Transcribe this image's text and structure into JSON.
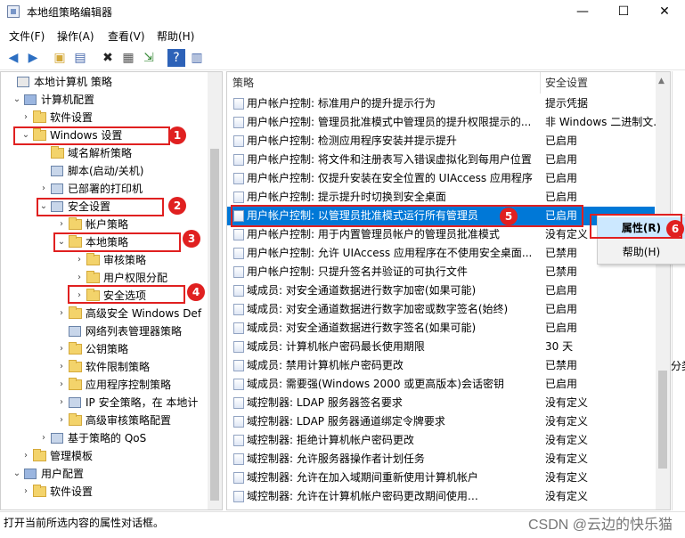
{
  "window": {
    "title": "本地组策略编辑器"
  },
  "menu": [
    "文件(F)",
    "操作(A)",
    "查看(V)",
    "帮助(H)"
  ],
  "toolbar_icons": [
    "back-arrow-icon",
    "forward-arrow-icon",
    "folder-up-icon",
    "show-hide-tree-icon",
    "delete-x-icon",
    "properties-icon",
    "export-icon",
    "help-icon",
    "console-icon"
  ],
  "tree": [
    {
      "label": "本地计算机 策略",
      "level": 0,
      "arrow": ""
    },
    {
      "label": "计算机配置",
      "level": 1,
      "arrow": "⌄"
    },
    {
      "label": "软件设置",
      "level": 2,
      "arrow": "›"
    },
    {
      "label": "Windows 设置",
      "level": 2,
      "arrow": "⌄"
    },
    {
      "label": "域名解析策略",
      "level": 3,
      "arrow": ""
    },
    {
      "label": "脚本(启动/关机)",
      "level": 3,
      "arrow": ""
    },
    {
      "label": "已部署的打印机",
      "level": 3,
      "arrow": "›"
    },
    {
      "label": "安全设置",
      "level": 3,
      "arrow": "⌄"
    },
    {
      "label": "帐户策略",
      "level": 4,
      "arrow": "›"
    },
    {
      "label": "本地策略",
      "level": 4,
      "arrow": "⌄"
    },
    {
      "label": "审核策略",
      "level": 5,
      "arrow": "›"
    },
    {
      "label": "用户权限分配",
      "level": 5,
      "arrow": "›"
    },
    {
      "label": "安全选项",
      "level": 5,
      "arrow": "›"
    },
    {
      "label": "高级安全 Windows Def",
      "level": 4,
      "arrow": "›"
    },
    {
      "label": "网络列表管理器策略",
      "level": 4,
      "arrow": ""
    },
    {
      "label": "公钥策略",
      "level": 4,
      "arrow": "›"
    },
    {
      "label": "软件限制策略",
      "level": 4,
      "arrow": "›"
    },
    {
      "label": "应用程序控制策略",
      "level": 4,
      "arrow": "›"
    },
    {
      "label": "IP 安全策略，在 本地计",
      "level": 4,
      "arrow": "›"
    },
    {
      "label": "高级审核策略配置",
      "level": 4,
      "arrow": "›"
    },
    {
      "label": "基于策略的 QoS",
      "level": 3,
      "arrow": "›"
    },
    {
      "label": "管理模板",
      "level": 2,
      "arrow": "›"
    },
    {
      "label": "用户配置",
      "level": 1,
      "arrow": "⌄"
    },
    {
      "label": "软件设置",
      "level": 2,
      "arrow": "›"
    }
  ],
  "table": {
    "headers": {
      "policy": "策略",
      "setting": "安全设置"
    },
    "rows": [
      {
        "name": "用户帐户控制: 标准用户的提升提示行为",
        "value": "提示凭据"
      },
      {
        "name": "用户帐户控制: 管理员批准模式中管理员的提升权限提示的...",
        "value": "非 Windows 二进制文..."
      },
      {
        "name": "用户帐户控制: 检测应用程序安装并提示提升",
        "value": "已启用"
      },
      {
        "name": "用户帐户控制: 将文件和注册表写入错误虚拟化到每用户位置",
        "value": "已启用"
      },
      {
        "name": "用户帐户控制: 仅提升安装在安全位置的 UIAccess 应用程序",
        "value": "已启用"
      },
      {
        "name": "用户帐户控制: 提示提升时切换到安全桌面",
        "value": "已启用"
      },
      {
        "name": "用户帐户控制: 以管理员批准模式运行所有管理员",
        "value": "已启用"
      },
      {
        "name": "用户帐户控制: 用于内置管理员帐户的管理员批准模式",
        "value": "没有定义"
      },
      {
        "name": "用户帐户控制: 允许 UIAccess 应用程序在不使用安全桌面...",
        "value": "已禁用"
      },
      {
        "name": "用户帐户控制: 只提升签名并验证的可执行文件",
        "value": "已禁用"
      },
      {
        "name": "域成员: 对安全通道数据进行数字加密(如果可能)",
        "value": "已启用"
      },
      {
        "name": "域成员: 对安全通道数据进行数字加密或数字签名(始终)",
        "value": "已启用"
      },
      {
        "name": "域成员: 对安全通道数据进行数字签名(如果可能)",
        "value": "已启用"
      },
      {
        "name": "域成员: 计算机帐户密码最长使用期限",
        "value": "30 天"
      },
      {
        "name": "域成员: 禁用计算机帐户密码更改",
        "value": "已禁用"
      },
      {
        "name": "域成员: 需要强(Windows 2000 或更高版本)会话密钥",
        "value": "已启用"
      },
      {
        "name": "域控制器: LDAP 服务器签名要求",
        "value": "没有定义"
      },
      {
        "name": "域控制器: LDAP 服务器通道绑定令牌要求",
        "value": "没有定义"
      },
      {
        "name": "域控制器: 拒绝计算机帐户密码更改",
        "value": "没有定义"
      },
      {
        "name": "域控制器: 允许服务器操作者计划任务",
        "value": "没有定义"
      },
      {
        "name": "域控制器:  允许在加入域期间重新使用计算机帐户",
        "value": "没有定义"
      },
      {
        "name": "域控制器: 允许在计算机帐户密码更改期间使用…",
        "value": "没有定义"
      }
    ]
  },
  "context_menu": {
    "properties": "属性(R)",
    "help": "帮助(H)"
  },
  "action_pane_fragment": "分类",
  "status_bar": {
    "text": "打开当前所选内容的属性对话框。",
    "watermark": "CSDN @云边的快乐猫"
  },
  "annotations": [
    "1",
    "2",
    "3",
    "4",
    "5",
    "6"
  ],
  "colors": {
    "selection": "#0078d7",
    "annotation_red": "#e02020",
    "context_hover": "#cce8ff"
  }
}
